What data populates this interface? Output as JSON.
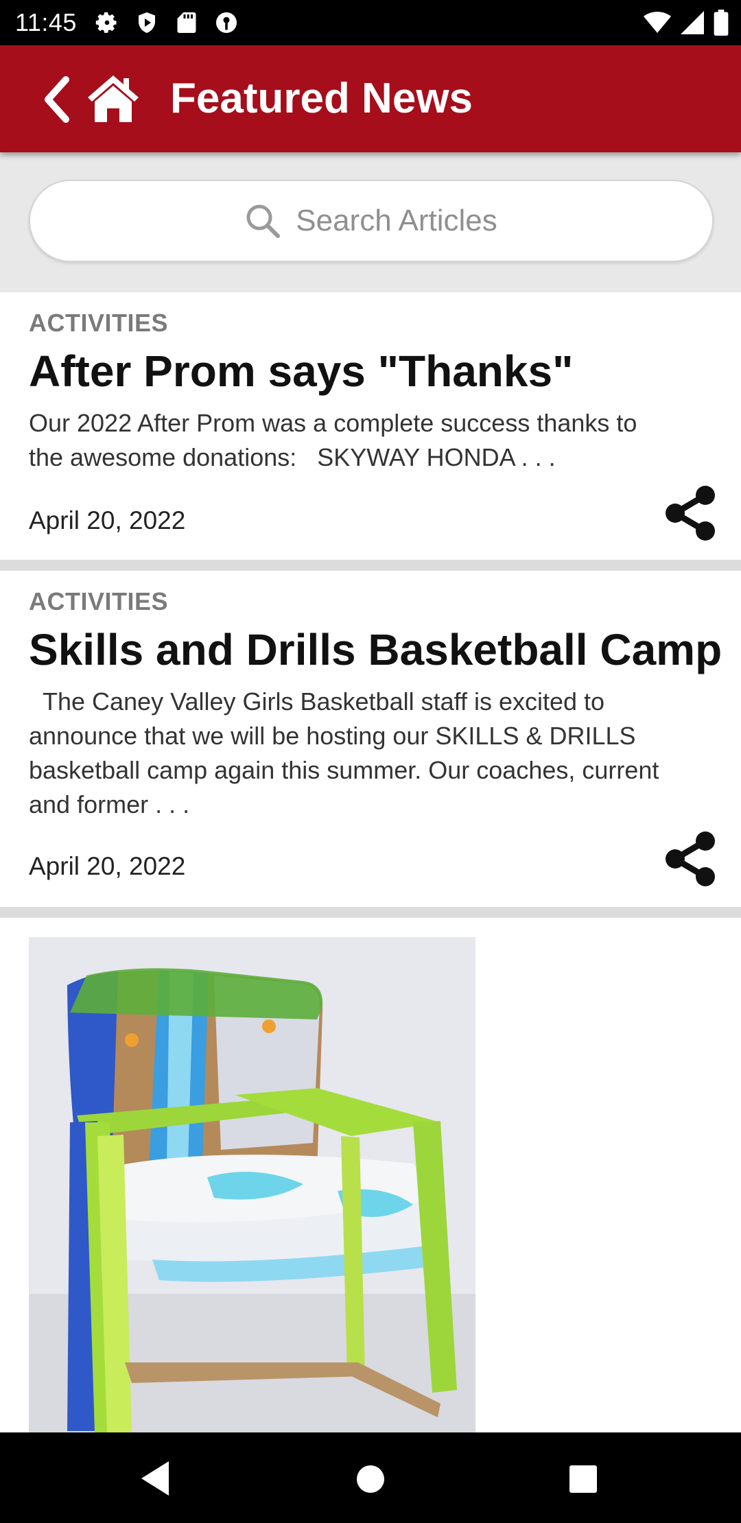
{
  "status_bar": {
    "time": "11:45",
    "left_icons": [
      "settings-icon",
      "shield-icon",
      "sd-card-icon",
      "key-icon"
    ],
    "right_icons": [
      "wifi-icon",
      "signal-icon",
      "battery-icon"
    ]
  },
  "app_bar": {
    "title": "Featured News",
    "background_color": "#a50e1a",
    "back_icon": "chevron-left-icon",
    "home_icon": "home-icon"
  },
  "search": {
    "placeholder": "Search Articles"
  },
  "articles": [
    {
      "category": "ACTIVITIES",
      "title": "After Prom says \"Thanks\"",
      "excerpt": "Our 2022 After Prom was a complete success thanks to\nthe awesome donations:   SKYWAY HONDA . . .",
      "date": "April 20, 2022"
    },
    {
      "category": "ACTIVITIES",
      "title": "Skills and Drills Basketball Camp",
      "excerpt": "  The Caney Valley Girls Basketball staff is excited to\nannounce that we will be hosting our SKILLS & DRILLS\nbasketball camp again this summer. Our coaches, current\nand former . . .",
      "date": "April 20, 2022"
    }
  ],
  "image_article": {
    "image_subject": "painted-chair-photo"
  },
  "nav_bar": {
    "icons": [
      "back-triangle-icon",
      "home-circle-icon",
      "recents-square-icon"
    ]
  }
}
